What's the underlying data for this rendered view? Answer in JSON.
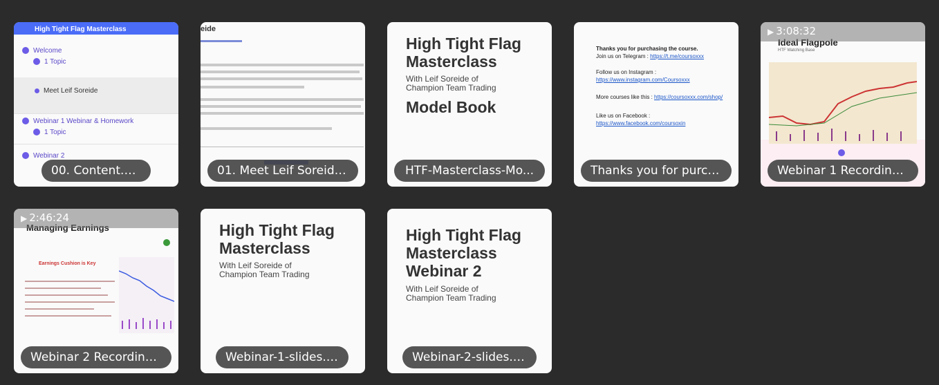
{
  "tiles": [
    {
      "name": "00. Content.png",
      "preview": {
        "header": "High Tight Flag Masterclass",
        "rows": [
          "Welcome",
          "1 Topic",
          "Meet Leif Soreide",
          "Webinar 1 Webinar & Homework",
          "1 Topic",
          "Webinar 2"
        ]
      }
    },
    {
      "name": "01. Meet Leif Soreide....",
      "preview": {
        "header": "eide"
      }
    },
    {
      "name": "HTF-Masterclass-Mo...",
      "preview": {
        "title": "High Tight Flag Masterclass",
        "subtitle_line1": "With Leif Soreide of",
        "subtitle_line2": "Champion Team Trading",
        "title2": "Model Book"
      }
    },
    {
      "name": "Thanks you for purch...",
      "preview": {
        "line1": "Thanks you for purchasing the course.",
        "line2": "Join us on Telegram :",
        "link2": "https://t.me/coursoxxx",
        "line3": "Follow us on Instagram :",
        "link3": "https://www.instagram.com/Coursoxxx",
        "line4": "More courses like this :",
        "link4": "https://coursoxxx.com/shop/",
        "line5": "Like us on Facebook :",
        "link5": "https://www.facebook.com/coursoxin"
      }
    },
    {
      "name": "Webinar 1 Recording ...",
      "duration": "3:08:32",
      "preview": {
        "title": "Ideal Flagpole",
        "subtitle": "HTF Watching Base"
      }
    },
    {
      "name": "Webinar 2 Recording ...",
      "duration": "2:46:24",
      "preview": {
        "title": "Managing Earnings",
        "subtitle": "Earnings Cushion is Key"
      }
    },
    {
      "name": "Webinar-1-slides.pdf",
      "preview": {
        "title": "High Tight Flag Masterclass",
        "subtitle_line1": "With Leif Soreide of",
        "subtitle_line2": "Champion Team Trading"
      }
    },
    {
      "name": "Webinar-2-slides.pdf",
      "preview": {
        "title": "High Tight Flag Masterclass Webinar 2",
        "subtitle_line1": "With Leif Soreide of",
        "subtitle_line2": "Champion Team Trading"
      }
    }
  ],
  "colors": {
    "background": "#2b2b2b",
    "pill": "#464646",
    "accent": "#4a6cf7"
  }
}
